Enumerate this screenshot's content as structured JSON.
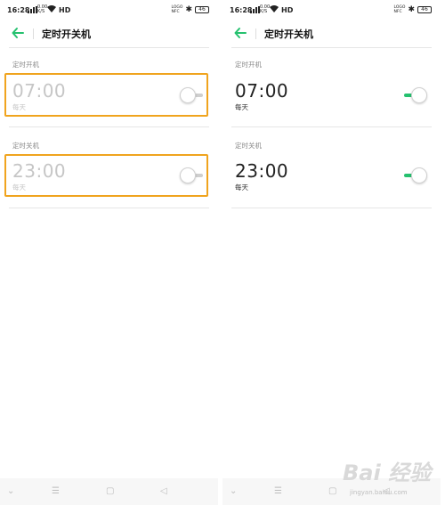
{
  "screens": [
    {
      "status": {
        "time": "16:28",
        "hd": "HD",
        "battery": "46",
        "net_up": "0.00",
        "net_down": "K/S",
        "nfc_top": "LOGO",
        "nfc_bottom": "NFC"
      },
      "title": "定时开关机",
      "power_on": {
        "label": "定时开机",
        "time": "07:00",
        "repeat": "每天",
        "enabled": false
      },
      "power_off": {
        "label": "定时关机",
        "time": "23:00",
        "repeat": "每天",
        "enabled": false
      }
    },
    {
      "status": {
        "time": "16:28",
        "hd": "HD",
        "battery": "46",
        "net_up": "0.00",
        "net_down": "K/S",
        "nfc_top": "LOGO",
        "nfc_bottom": "NFC"
      },
      "title": "定时开关机",
      "power_on": {
        "label": "定时开机",
        "time": "07:00",
        "repeat": "每天",
        "enabled": true
      },
      "power_off": {
        "label": "定时关机",
        "time": "23:00",
        "repeat": "每天",
        "enabled": true
      }
    }
  ],
  "nav_icons": [
    "chevron-down-icon",
    "menu-icon",
    "home-icon",
    "back-triangle-icon"
  ],
  "colors": {
    "accent": "#25c16f",
    "highlight": "#f0a41e"
  },
  "watermark": {
    "main": "Bai 经验",
    "sub": "jingyan.baidu.com"
  }
}
